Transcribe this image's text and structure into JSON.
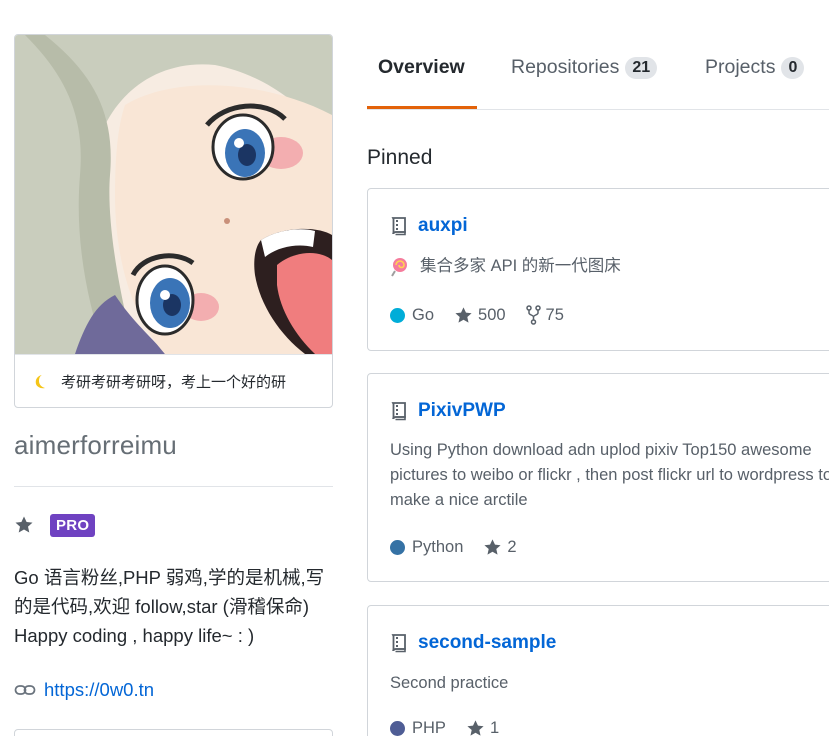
{
  "profile": {
    "status_text": "考研考研考研呀，考上一个好的研",
    "status_emoji": "crescent-moon-icon",
    "username": "aimerforreimu",
    "pro_badge": "PRO",
    "bio": "Go 语言粉丝,PHP 弱鸡,学的是机械,写的是代码,欢迎 follow,star (滑稽保命) Happy coding , happy life~ : )",
    "blog_url": "https://0w0.tn"
  },
  "tabs": [
    {
      "label": "Overview",
      "count": null,
      "active": true
    },
    {
      "label": "Repositories",
      "count": "21",
      "active": false
    },
    {
      "label": "Projects",
      "count": "0",
      "active": false
    }
  ],
  "pinned": {
    "title": "Pinned",
    "repos": [
      {
        "name": "auxpi",
        "description": "集合多家 API 的新一代图床",
        "description_emoji": "lollipop-icon",
        "language": "Go",
        "language_color": "#00ADD8",
        "stars": "500",
        "forks": "75"
      },
      {
        "name": "PixivPWP",
        "description": "Using Python download adn uplod pixiv Top150 awesome pictures to weibo or flickr , then post flickr url to wordpress to make a nice arctile",
        "language": "Python",
        "language_color": "#3572A5",
        "stars": "2"
      },
      {
        "name": "second-sample",
        "description": "Second practice",
        "language": "PHP",
        "language_color": "#4F5D95",
        "stars": "1"
      }
    ]
  },
  "colors": {
    "link": "#0366d6",
    "pro": "#6f42c1",
    "tab_underline": "#e36209"
  }
}
